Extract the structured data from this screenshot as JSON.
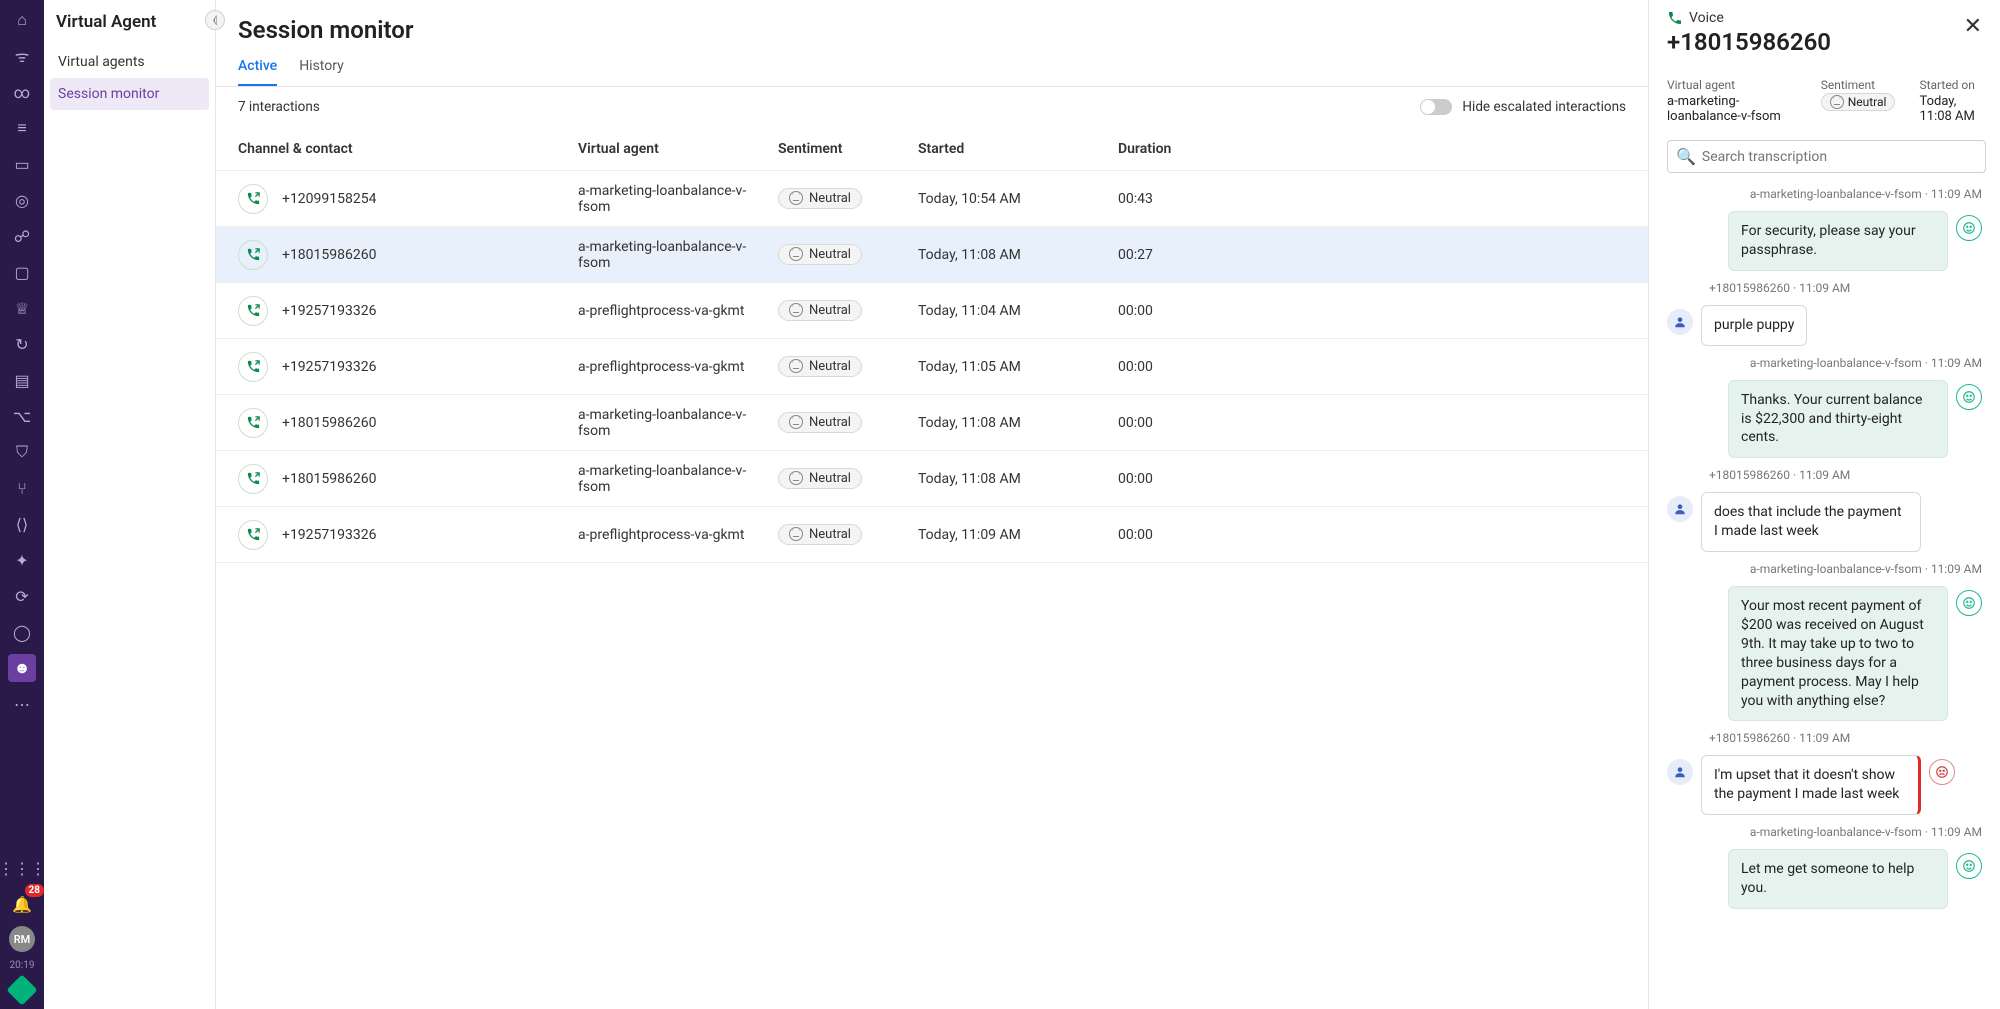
{
  "rail": {
    "badge_count": "28",
    "avatar_initials": "RM",
    "time": "20:19"
  },
  "leftnav": {
    "title": "Virtual Agent",
    "items": [
      "Virtual agents",
      "Session monitor"
    ],
    "selectedIndex": 1
  },
  "page": {
    "title": "Session monitor",
    "tabs": [
      "Active",
      "History"
    ],
    "activeTab": 0,
    "count": "7 interactions",
    "hideEscalatedLabel": "Hide escalated interactions"
  },
  "table": {
    "columns": [
      "Channel & contact",
      "Virtual agent",
      "Sentiment",
      "Started",
      "Duration"
    ],
    "rows": [
      {
        "contact": "+12099158254",
        "agent": "a-marketing-loanbalance-v-fsom",
        "sentiment": "Neutral",
        "started": "Today, 10:54 AM",
        "duration": "00:43"
      },
      {
        "contact": "+18015986260",
        "agent": "a-marketing-loanbalance-v-fsom",
        "sentiment": "Neutral",
        "started": "Today, 11:08 AM",
        "duration": "00:27",
        "selected": true
      },
      {
        "contact": "+19257193326",
        "agent": "a-preflightprocess-va-gkmt",
        "sentiment": "Neutral",
        "started": "Today, 11:04 AM",
        "duration": "00:00"
      },
      {
        "contact": "+19257193326",
        "agent": "a-preflightprocess-va-gkmt",
        "sentiment": "Neutral",
        "started": "Today, 11:05 AM",
        "duration": "00:00"
      },
      {
        "contact": "+18015986260",
        "agent": "a-marketing-loanbalance-v-fsom",
        "sentiment": "Neutral",
        "started": "Today, 11:08 AM",
        "duration": "00:00"
      },
      {
        "contact": "+18015986260",
        "agent": "a-marketing-loanbalance-v-fsom",
        "sentiment": "Neutral",
        "started": "Today, 11:08 AM",
        "duration": "00:00"
      },
      {
        "contact": "+19257193326",
        "agent": "a-preflightprocess-va-gkmt",
        "sentiment": "Neutral",
        "started": "Today, 11:09 AM",
        "duration": "00:00"
      }
    ]
  },
  "rpanel": {
    "voiceLabel": "Voice",
    "phone": "+18015986260",
    "meta": {
      "virtualAgentLabel": "Virtual agent",
      "virtualAgent": "a-marketing-loanbalance-v-fsom",
      "sentimentLabel": "Sentiment",
      "sentiment": "Neutral",
      "startedLabel": "Started on",
      "started": "Today, 11:08 AM"
    },
    "searchPlaceholder": "Search transcription",
    "messages": [
      {
        "side": "agent",
        "meta": "a-marketing-loanbalance-v-fsom · 11:09 AM",
        "text": "For security, please say your passphrase."
      },
      {
        "side": "user",
        "meta": "+18015986260 · 11:09 AM",
        "text": "purple puppy"
      },
      {
        "side": "agent",
        "meta": "a-marketing-loanbalance-v-fsom · 11:09 AM",
        "text": "Thanks. Your current balance is $22,300 and thirty-eight cents."
      },
      {
        "side": "user",
        "meta": "+18015986260 · 11:09 AM",
        "text": "does that include the payment I made last week"
      },
      {
        "side": "agent",
        "meta": "a-marketing-loanbalance-v-fsom · 11:09 AM",
        "text": "Your most recent payment of $200 was received on August 9th. It may take up to two to three business days for a payment process. May I help you with anything else?"
      },
      {
        "side": "user",
        "meta": "+18015986260 · 11:09 AM",
        "text": "I'm upset that it doesn't show the payment I made last week",
        "negative": true
      },
      {
        "side": "agent",
        "meta": "a-marketing-loanbalance-v-fsom · 11:09 AM",
        "text": "Let me get someone to help you."
      }
    ]
  }
}
